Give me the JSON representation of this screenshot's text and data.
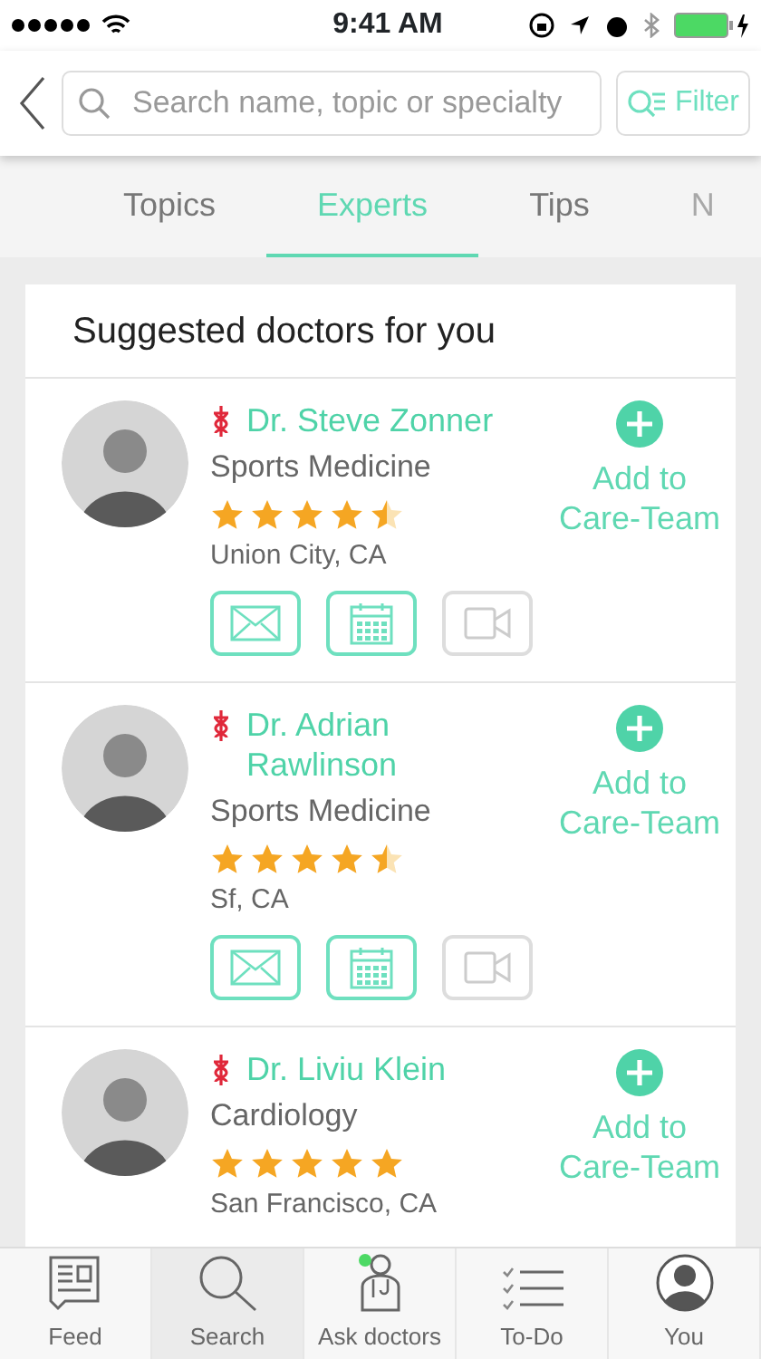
{
  "status_bar": {
    "time": "9:41 AM"
  },
  "header": {
    "search": {
      "placeholder": "Search name, topic or specialty"
    },
    "filter": "Filter"
  },
  "tabs": [
    {
      "label": "Topics",
      "selected": false
    },
    {
      "label": "Experts",
      "selected": true
    },
    {
      "label": "Tips",
      "selected": false
    },
    {
      "label": "N",
      "selected": false
    }
  ],
  "section_title": "Suggested doctors for you",
  "doctors": [
    {
      "name": "Dr. Steve Zonner",
      "specialty": "Sports Medicine",
      "stars": 4.5,
      "location": "Union City, CA",
      "add_label": "Add to Care-Team",
      "actions": [
        {
          "kind": "message",
          "disabled": false
        },
        {
          "kind": "calendar",
          "disabled": false
        },
        {
          "kind": "video",
          "disabled": true
        }
      ]
    },
    {
      "name": "Dr. Adrian Rawlinson",
      "specialty": "Sports Medicine",
      "stars": 4.5,
      "location": "Sf, CA",
      "add_label": "Add to Care-Team",
      "actions": [
        {
          "kind": "message",
          "disabled": false
        },
        {
          "kind": "calendar",
          "disabled": false
        },
        {
          "kind": "video",
          "disabled": true
        }
      ]
    },
    {
      "name": "Dr. Liviu Klein",
      "specialty": "Cardiology",
      "stars": 5,
      "location": "San Francisco, CA",
      "add_label": "Add to Care-Team"
    }
  ],
  "tab_bar": [
    {
      "kind": "feed",
      "label": "Feed",
      "selected": false,
      "notification": false
    },
    {
      "kind": "search",
      "label": "Search",
      "selected": true,
      "notification": false
    },
    {
      "kind": "doctor",
      "label": "Ask doctors",
      "selected": false,
      "notification": true
    },
    {
      "kind": "todo",
      "label": "To-Do",
      "selected": false,
      "notification": false
    },
    {
      "kind": "profile",
      "label": "You",
      "selected": false,
      "notification": false
    }
  ]
}
